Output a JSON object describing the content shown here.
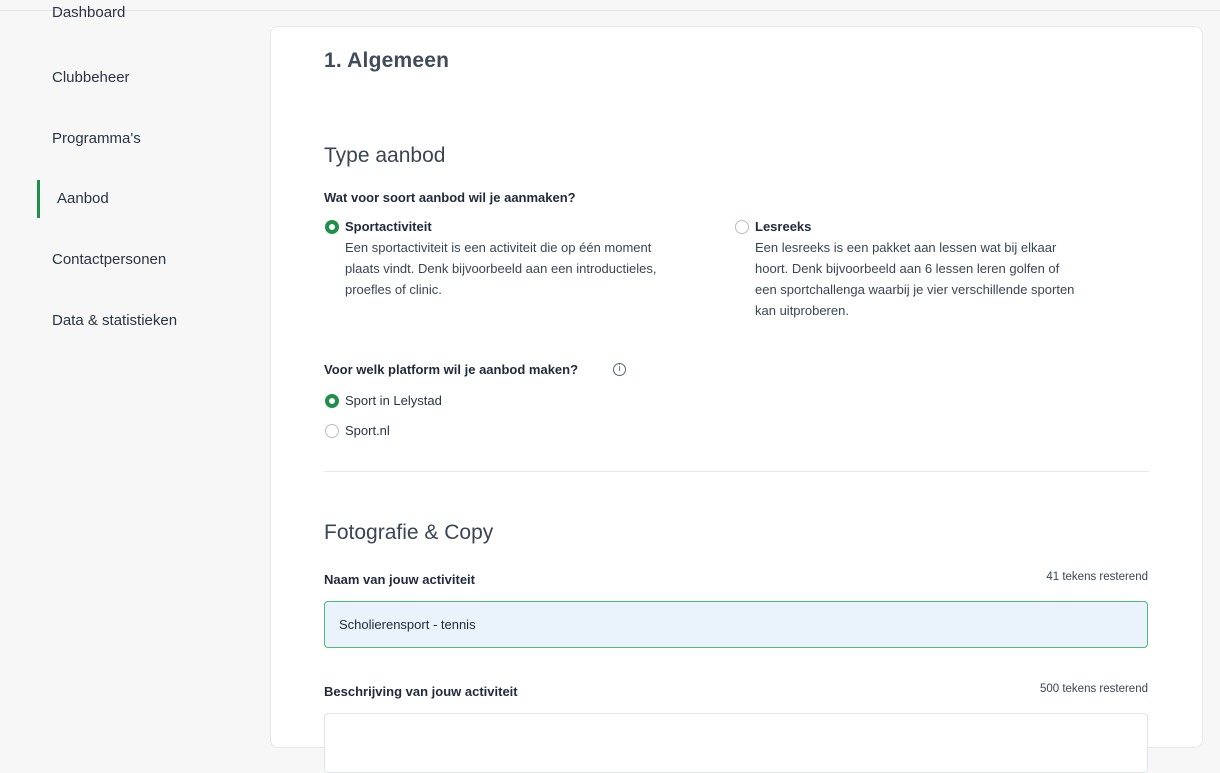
{
  "sidebar": {
    "items": [
      {
        "label": "Dashboard"
      },
      {
        "label": "Clubbeheer"
      },
      {
        "label": "Programma's"
      },
      {
        "label": "Aanbod"
      },
      {
        "label": "Contactpersonen"
      },
      {
        "label": "Data & statistieken"
      }
    ],
    "active": "Aanbod"
  },
  "main": {
    "section_title": "1. Algemeen",
    "type_aanbod": {
      "heading": "Type aanbod",
      "question": "Wat voor soort aanbod wil je aanmaken?",
      "options": [
        {
          "title": "Sportactiviteit",
          "selected": true,
          "desc_lines": [
            "Een sportactiviteit is een activiteit die op één moment",
            "plaats vindt. Denk bijvoorbeeld aan een introductieles,",
            "proefles of clinic."
          ]
        },
        {
          "title": "Lesreeks",
          "selected": false,
          "desc_lines": [
            "Een lesreeks is een pakket aan lessen wat bij elkaar",
            "hoort. Denk bijvoorbeeld aan 6 lessen leren golfen of",
            "een sportchallenga waarbij je vier verschillende sporten",
            "kan uitproberen."
          ]
        }
      ]
    },
    "platform": {
      "question": "Voor welk platform wil je aanbod maken?",
      "info_icon": "info-icon",
      "options": [
        {
          "label": "Sport in Lelystad",
          "selected": true
        },
        {
          "label": "Sport.nl",
          "selected": false
        }
      ]
    },
    "foto_copy": {
      "heading": "Fotografie & Copy",
      "naam": {
        "label": "Naam van jouw activiteit",
        "counter": "41 tekens resterend",
        "value": "Scholierensport - tennis"
      },
      "beschrijving": {
        "label": "Beschrijving van jouw activiteit",
        "counter": "500 tekens resterend",
        "value": ""
      }
    }
  },
  "colors": {
    "accent": "#1f8f4a",
    "input_border_active": "#4cbd73",
    "input_bg_active": "#eaf2fb"
  }
}
